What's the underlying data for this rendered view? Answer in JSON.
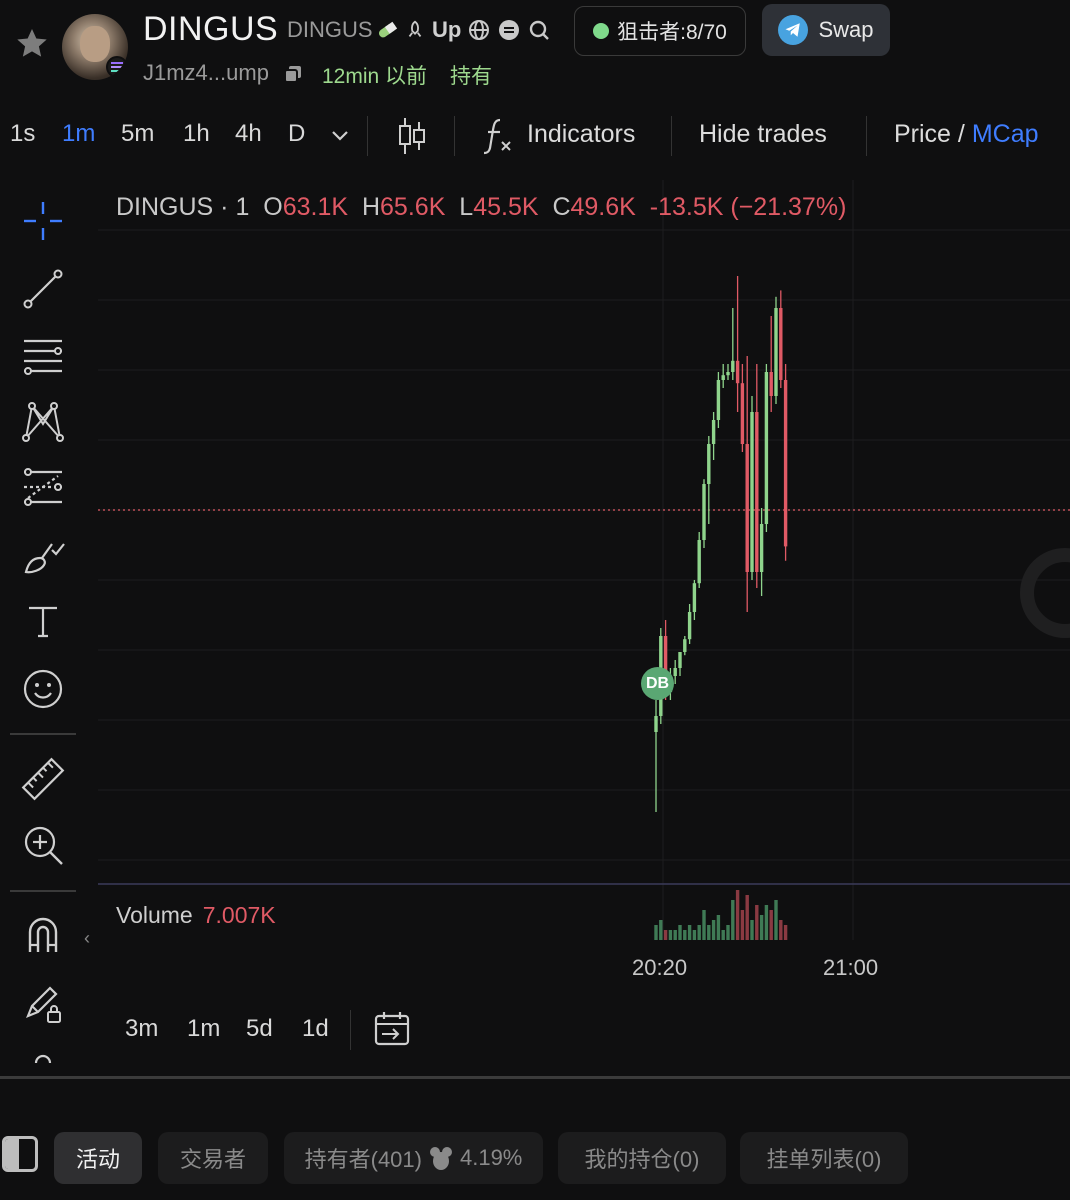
{
  "header": {
    "title": "DINGUS",
    "symbol": "DINGUS",
    "up_label": "Up",
    "address": "J1mz4...ump",
    "age": "12min 以前",
    "holding_label": "持有",
    "sniper_label": "狙击者:8/70",
    "swap_label": "Swap",
    "icons": [
      "star-icon",
      "pill-icon",
      "rocket-icon",
      "globe-icon",
      "chat-icon",
      "search-icon",
      "telegram-icon",
      "copy-icon"
    ]
  },
  "toolbar": {
    "timeframes": [
      "1s",
      "1m",
      "5m",
      "1h",
      "4h",
      "D"
    ],
    "active_timeframe": "1m",
    "indicators_label": "Indicators",
    "hide_trades_label": "Hide trades",
    "price_label": "Price",
    "slash": "/",
    "mcap_label": "MCap"
  },
  "legend": {
    "name": "DINGUS · 1",
    "o_label": "O",
    "o": "63.1K",
    "h_label": "H",
    "h": "65.6K",
    "l_label": "L",
    "l": "45.5K",
    "c_label": "C",
    "c": "49.6K",
    "change": "-13.5K (−21.37%)"
  },
  "volume": {
    "label": "Volume",
    "value": "7.007K"
  },
  "marker": {
    "label": "DB"
  },
  "ranges": [
    "3m",
    "1m",
    "5d",
    "1d"
  ],
  "tabs": [
    {
      "label": "活动",
      "active": true
    },
    {
      "label": "交易者",
      "active": false
    },
    {
      "label": "持有者(401)",
      "extra": "4.19%",
      "active": false
    },
    {
      "label": "我的持仓(0)",
      "active": false
    },
    {
      "label": "挂单列表(0)",
      "active": false
    }
  ],
  "colors": {
    "up": "#8fd48c",
    "down": "#e05a65",
    "accent": "#3f7dff",
    "background": "#0f0f10"
  },
  "chart_data": {
    "type": "candlestick",
    "x_ticks": [
      "20:20",
      "21:00"
    ],
    "last_price_line": "dotted red",
    "candles": [
      {
        "o": 38000,
        "h": 40000,
        "l": 33000,
        "c": 39000
      },
      {
        "o": 39000,
        "h": 44500,
        "l": 38500,
        "c": 44000
      },
      {
        "o": 44000,
        "h": 45000,
        "l": 40000,
        "c": 40500
      },
      {
        "o": 40500,
        "h": 42000,
        "l": 40000,
        "c": 41500
      },
      {
        "o": 41500,
        "h": 42500,
        "l": 41000,
        "c": 42000
      },
      {
        "o": 42000,
        "h": 43000,
        "l": 41500,
        "c": 43000
      },
      {
        "o": 43000,
        "h": 44000,
        "l": 42800,
        "c": 43800
      },
      {
        "o": 43800,
        "h": 46000,
        "l": 43500,
        "c": 45500
      },
      {
        "o": 45500,
        "h": 47500,
        "l": 45000,
        "c": 47300
      },
      {
        "o": 47300,
        "h": 50500,
        "l": 47000,
        "c": 50000
      },
      {
        "o": 50000,
        "h": 53800,
        "l": 49500,
        "c": 53500
      },
      {
        "o": 53500,
        "h": 56500,
        "l": 51000,
        "c": 56000
      },
      {
        "o": 56000,
        "h": 58000,
        "l": 55000,
        "c": 57500
      },
      {
        "o": 57500,
        "h": 60500,
        "l": 57000,
        "c": 60000
      },
      {
        "o": 60000,
        "h": 61000,
        "l": 59500,
        "c": 60300
      },
      {
        "o": 60300,
        "h": 61000,
        "l": 60000,
        "c": 60500
      },
      {
        "o": 60500,
        "h": 64500,
        "l": 60000,
        "c": 61200
      },
      {
        "o": 61200,
        "h": 66500,
        "l": 58000,
        "c": 59800
      },
      {
        "o": 59800,
        "h": 61000,
        "l": 55500,
        "c": 56000
      },
      {
        "o": 56000,
        "h": 61500,
        "l": 45500,
        "c": 48000
      },
      {
        "o": 48000,
        "h": 59000,
        "l": 47500,
        "c": 58000
      },
      {
        "o": 58000,
        "h": 61000,
        "l": 47000,
        "c": 48000
      },
      {
        "o": 48000,
        "h": 52000,
        "l": 46500,
        "c": 51000
      },
      {
        "o": 51000,
        "h": 61000,
        "l": 50500,
        "c": 60500
      },
      {
        "o": 60500,
        "h": 64000,
        "l": 58000,
        "c": 59000
      },
      {
        "o": 59000,
        "h": 65200,
        "l": 58500,
        "c": 64500
      },
      {
        "o": 64500,
        "h": 65600,
        "l": 59500,
        "c": 60000
      },
      {
        "o": 60000,
        "h": 61000,
        "l": 48700,
        "c": 49600
      }
    ],
    "volumes": [
      3,
      4,
      2,
      2,
      2,
      3,
      2,
      3,
      2,
      3,
      6,
      3,
      4,
      5,
      2,
      3,
      8,
      10,
      6,
      9,
      4,
      7,
      5,
      7,
      6,
      8,
      4,
      3
    ]
  }
}
